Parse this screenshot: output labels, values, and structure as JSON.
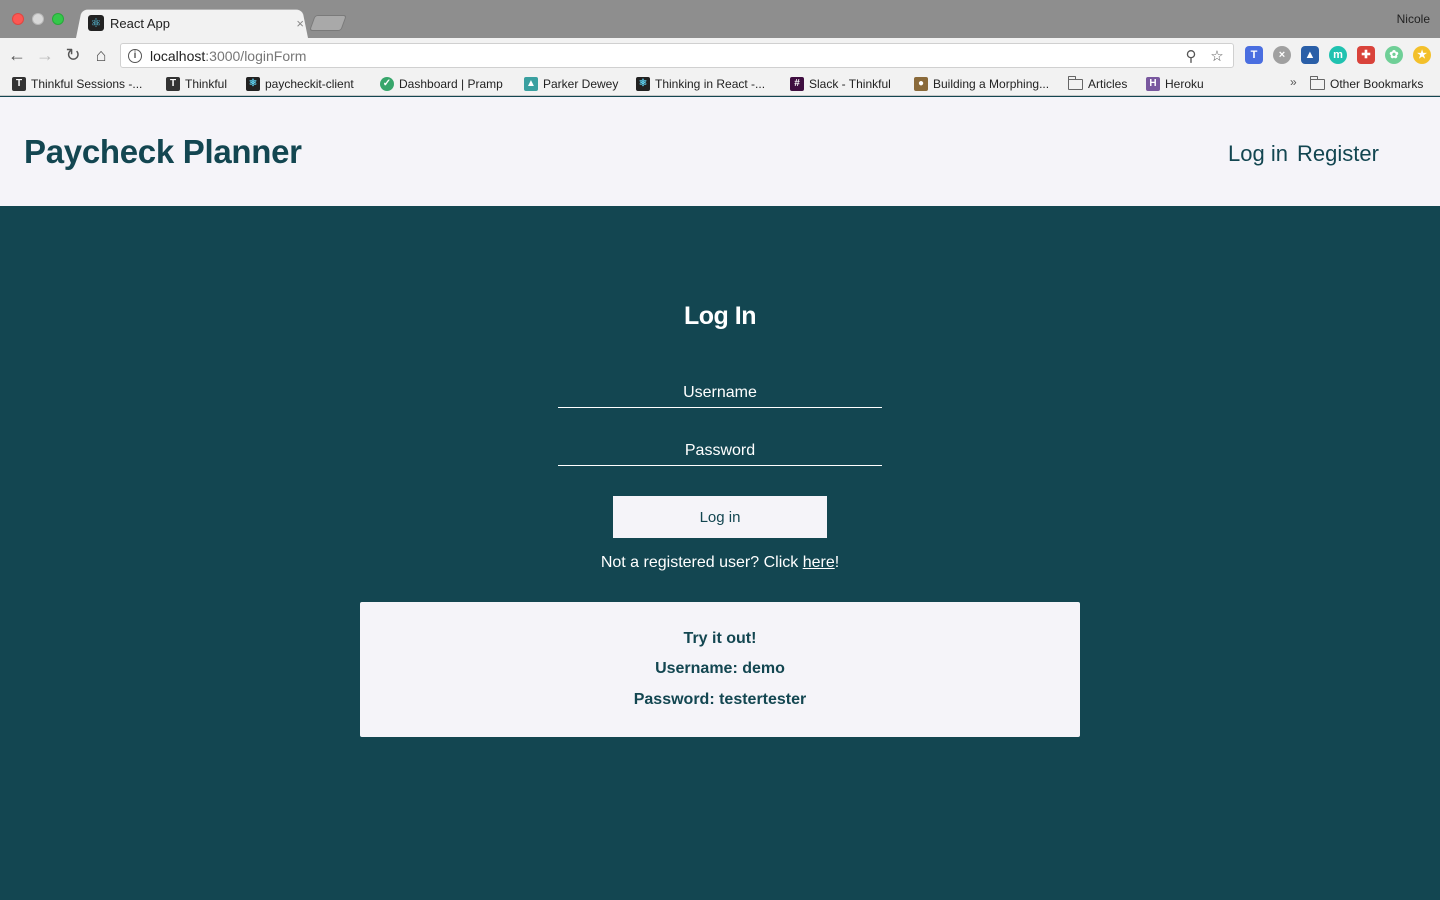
{
  "browser": {
    "tab_title": "React App",
    "tab_close": "×",
    "profile_name": "Nicole",
    "url_host": "localhost",
    "url_path": ":3000/loginForm",
    "bookmarks": [
      {
        "label": "Thinkful Sessions -...",
        "icon": "thinkful-icon"
      },
      {
        "label": "Thinkful",
        "icon": "thinkful-icon"
      },
      {
        "label": "paycheckit-client",
        "icon": "react-icon"
      },
      {
        "label": "Dashboard | Pramp",
        "icon": "pramp-icon"
      },
      {
        "label": "Parker Dewey",
        "icon": "parker-dewey-icon"
      },
      {
        "label": "Thinking in React -...",
        "icon": "react-icon"
      },
      {
        "label": "Slack - Thinkful",
        "icon": "slack-icon"
      },
      {
        "label": "Building a Morphing...",
        "icon": "person-icon"
      },
      {
        "label": "Articles",
        "icon": "folder-icon"
      },
      {
        "label": "Heroku",
        "icon": "heroku-icon"
      }
    ],
    "overflow": "»",
    "other_bookmarks": "Other Bookmarks"
  },
  "app": {
    "brand": "Paycheck Planner",
    "nav": {
      "login": "Log in",
      "register": "Register"
    },
    "form": {
      "title": "Log In",
      "username_placeholder": "Username",
      "password_placeholder": "Password",
      "submit_label": "Log in",
      "register_prefix": "Not a registered user? Click ",
      "register_link": "here",
      "register_suffix": "!"
    },
    "demo": {
      "line1": "Try it out!",
      "line2": "Username: demo",
      "line3": "Password: testertester"
    }
  },
  "colors": {
    "brand_teal": "#134651",
    "header_bg": "#f5f4f9"
  }
}
